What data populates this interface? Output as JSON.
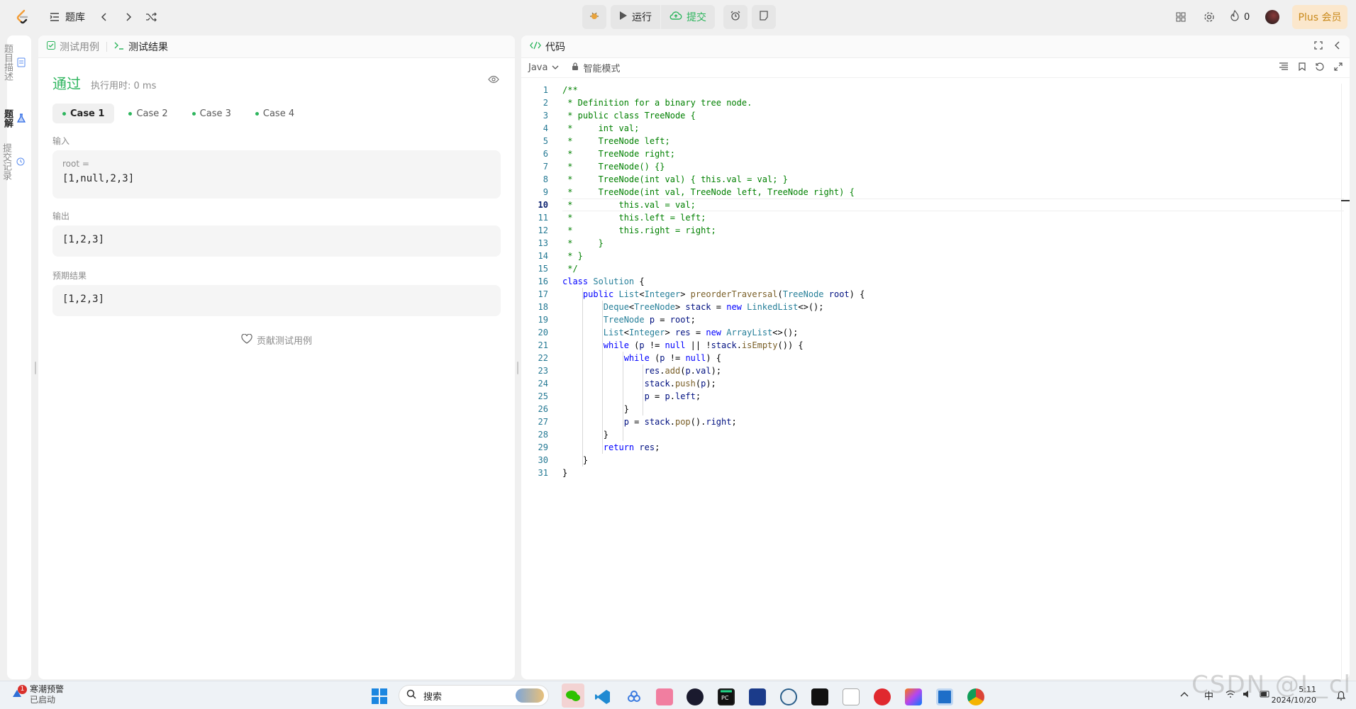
{
  "header": {
    "problem_bank": "题库",
    "run_label": "运行",
    "submit_label": "提交",
    "streak_count": "0",
    "plus_label": "Plus 会员"
  },
  "vtabs": [
    "题目描述",
    "题解",
    "提交记录"
  ],
  "left_panel": {
    "tab_testcase": "测试用例",
    "tab_result": "测试结果",
    "status": "通过",
    "runtime": "执行用时: 0 ms",
    "cases": [
      "Case 1",
      "Case 2",
      "Case 3",
      "Case 4"
    ],
    "input_label": "输入",
    "input_var": "root =",
    "input_value": "[1,null,2,3]",
    "output_label": "输出",
    "output_value": "[1,2,3]",
    "expected_label": "预期结果",
    "expected_value": "[1,2,3]",
    "contribute": "贡献测试用例"
  },
  "right_panel": {
    "title": "代码",
    "language": "Java",
    "mode": "智能模式",
    "current_line": 10
  },
  "code_lines": [
    [
      [
        "cm",
        "/**"
      ]
    ],
    [
      [
        "cm",
        " * Definition for a binary tree node."
      ]
    ],
    [
      [
        "cm",
        " * public class TreeNode {"
      ]
    ],
    [
      [
        "cm",
        " *     int val;"
      ]
    ],
    [
      [
        "cm",
        " *     TreeNode left;"
      ]
    ],
    [
      [
        "cm",
        " *     TreeNode right;"
      ]
    ],
    [
      [
        "cm",
        " *     TreeNode() {}"
      ]
    ],
    [
      [
        "cm",
        " *     TreeNode(int val) { this.val = val; }"
      ]
    ],
    [
      [
        "cm",
        " *     TreeNode(int val, TreeNode left, TreeNode right) {"
      ]
    ],
    [
      [
        "cm",
        " *         this.val = val;"
      ]
    ],
    [
      [
        "cm",
        " *         this.left = left;"
      ]
    ],
    [
      [
        "cm",
        " *         this.right = right;"
      ]
    ],
    [
      [
        "cm",
        " *     }"
      ]
    ],
    [
      [
        "cm",
        " * }"
      ]
    ],
    [
      [
        "cm",
        " */"
      ]
    ],
    [
      [
        "kw",
        "class "
      ],
      [
        "ty",
        "Solution"
      ],
      [
        "",
        " {"
      ]
    ],
    [
      [
        "",
        "    "
      ],
      [
        "kw",
        "public "
      ],
      [
        "ty",
        "List"
      ],
      [
        "",
        "<"
      ],
      [
        "ty",
        "Integer"
      ],
      [
        "",
        "> "
      ],
      [
        "fn",
        "preorderTraversal"
      ],
      [
        "",
        "("
      ],
      [
        "ty",
        "TreeNode "
      ],
      [
        "vr",
        "root"
      ],
      [
        "",
        ") {"
      ]
    ],
    [
      [
        "",
        "        "
      ],
      [
        "ty",
        "Deque"
      ],
      [
        "",
        "<"
      ],
      [
        "ty",
        "TreeNode"
      ],
      [
        "",
        "> "
      ],
      [
        "vr",
        "stack"
      ],
      [
        "",
        " = "
      ],
      [
        "kw",
        "new "
      ],
      [
        "ty",
        "LinkedList"
      ],
      [
        "",
        "<>();"
      ]
    ],
    [
      [
        "",
        "        "
      ],
      [
        "ty",
        "TreeNode "
      ],
      [
        "vr",
        "p"
      ],
      [
        "",
        " = "
      ],
      [
        "vr",
        "root"
      ],
      [
        "",
        ";"
      ]
    ],
    [
      [
        "",
        "        "
      ],
      [
        "ty",
        "List"
      ],
      [
        "",
        "<"
      ],
      [
        "ty",
        "Integer"
      ],
      [
        "",
        "> "
      ],
      [
        "vr",
        "res"
      ],
      [
        "",
        " = "
      ],
      [
        "kw",
        "new "
      ],
      [
        "ty",
        "ArrayList"
      ],
      [
        "",
        "<>();"
      ]
    ],
    [
      [
        "",
        "        "
      ],
      [
        "kw",
        "while "
      ],
      [
        "",
        "("
      ],
      [
        "vr",
        "p"
      ],
      [
        "",
        " != "
      ],
      [
        "kw",
        "null"
      ],
      [
        "",
        " || !"
      ],
      [
        "vr",
        "stack"
      ],
      [
        "",
        "."
      ],
      [
        "fn",
        "isEmpty"
      ],
      [
        "",
        "()) {"
      ]
    ],
    [
      [
        "",
        "            "
      ],
      [
        "kw",
        "while "
      ],
      [
        "",
        "("
      ],
      [
        "vr",
        "p"
      ],
      [
        "",
        " != "
      ],
      [
        "kw",
        "null"
      ],
      [
        "",
        ") {"
      ]
    ],
    [
      [
        "",
        "                "
      ],
      [
        "vr",
        "res"
      ],
      [
        "",
        "."
      ],
      [
        "fn",
        "add"
      ],
      [
        "",
        "("
      ],
      [
        "vr",
        "p"
      ],
      [
        "",
        "."
      ],
      [
        "vr",
        "val"
      ],
      [
        "",
        ");"
      ]
    ],
    [
      [
        "",
        "                "
      ],
      [
        "vr",
        "stack"
      ],
      [
        "",
        "."
      ],
      [
        "fn",
        "push"
      ],
      [
        "",
        "("
      ],
      [
        "vr",
        "p"
      ],
      [
        "",
        ");"
      ]
    ],
    [
      [
        "",
        "                "
      ],
      [
        "vr",
        "p"
      ],
      [
        "",
        " = "
      ],
      [
        "vr",
        "p"
      ],
      [
        "",
        "."
      ],
      [
        "vr",
        "left"
      ],
      [
        "",
        ";"
      ]
    ],
    [
      [
        "",
        "            }"
      ]
    ],
    [
      [
        "",
        "            "
      ],
      [
        "vr",
        "p"
      ],
      [
        "",
        " = "
      ],
      [
        "vr",
        "stack"
      ],
      [
        "",
        "."
      ],
      [
        "fn",
        "pop"
      ],
      [
        "",
        "()."
      ],
      [
        "vr",
        "right"
      ],
      [
        "",
        ";"
      ]
    ],
    [
      [
        "",
        "        }"
      ]
    ],
    [
      [
        "",
        "        "
      ],
      [
        "kw",
        "return "
      ],
      [
        "vr",
        "res"
      ],
      [
        "",
        ";"
      ]
    ],
    [
      [
        "",
        "    }"
      ]
    ],
    [
      [
        "",
        "}"
      ]
    ]
  ],
  "taskbar": {
    "weather_title": "寒潮预警",
    "weather_sub": "已启动",
    "weather_badge": "1",
    "search_placeholder": "搜索",
    "ime": "中",
    "time": "5:11",
    "date": "2024/10/20"
  },
  "watermark": "CSDN @L_cl"
}
